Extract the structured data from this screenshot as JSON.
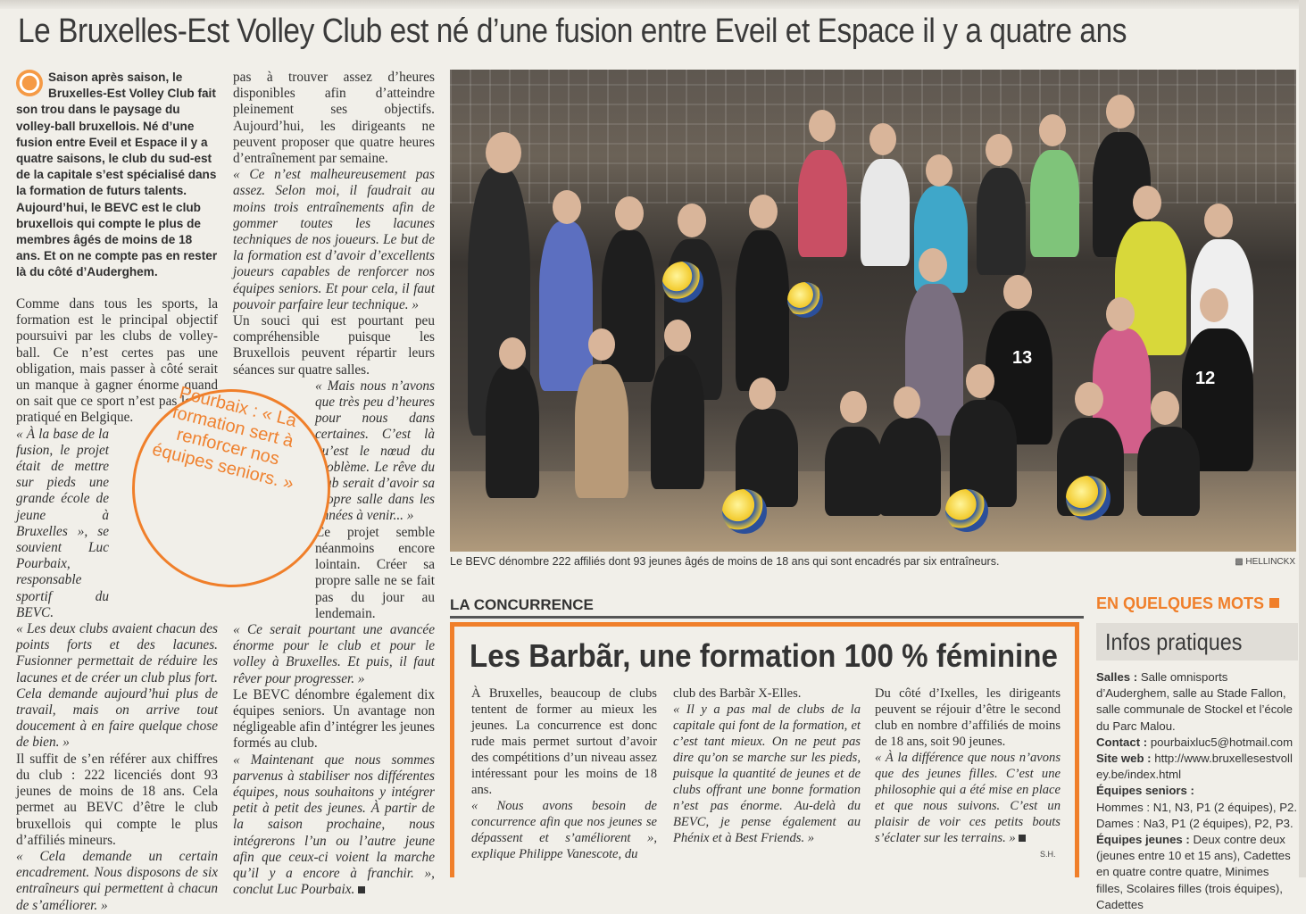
{
  "headline": "Le Bruxelles-Est Volley Club est né d’une fusion entre Eveil et Espace il y a quatre ans",
  "lead": "Saison après saison, le Bruxelles-Est Volley Club fait son trou dans le paysage du volley-ball bruxellois. Né d’une fusion entre Eveil et Espace il y a quatre saisons, le club du sud-est de la capitale s’est spécialisé dans la formation de futurs talents. Aujourd’hui, le BEVC est le club bruxellois qui compte le plus de membres âgés de moins de 18 ans. Et on ne compte pas en rester là du côté d’Auderghem.",
  "col1": {
    "p1": "Comme dans tous les sports, la formation est le principal objectif poursuivi par les clubs de volley-ball. Ce n’est certes pas une obligation, mais passer à côté serait un manque à gagner énorme quand on sait que ce sport n’est pas le plus pratiqué en Belgique.",
    "p2": "« À la base de la fusion, le projet était de mettre sur pieds une grande école de jeune à Bruxelles », se souvient Luc Pourbaix, responsable sportif du BEVC.",
    "p3": "« Les deux clubs avaient chacun des points forts et des lacunes. Fusionner permettait de réduire les lacunes et de créer un club plus fort. Cela demande aujourd’hui plus de travail, mais on arrive tout doucement à en faire quelque chose de bien. »",
    "p4": "Il suffit de s’en référer aux chiffres du club : 222 licenciés dont 93 jeunes de moins de 18 ans. Cela permet au BEVC d’être le club bruxellois qui compte le plus d’affiliés mineurs.",
    "p5": "« Cela demande un certain encadrement. Nous disposons de six entraîneurs qui permettent à chacun de s’améliorer. »"
  },
  "col2": {
    "p1": "pas à trouver assez d’heures disponibles afin d’atteindre pleinement ses objectifs. Aujourd’hui, les dirigeants ne peuvent proposer que quatre heures d’entraînement par semaine.",
    "p2": "« Ce n’est malheureusement pas assez. Selon moi, il faudrait au moins trois entraînements afin de gommer toutes les lacunes techniques de nos joueurs. Le but de la formation est d’avoir d’excellents joueurs capables de renforcer nos équipes seniors. Et pour cela, il faut pouvoir parfaire leur technique. »",
    "p3": "Un souci qui est pourtant peu compréhensible puisque les Bruxellois peuvent répartir leurs séances sur quatre salles.",
    "p4": "« Mais nous n’avons que très peu d’heures pour nous dans certaines. C’est là qu’est le nœud du problème. Le rêve du club serait d’avoir sa propre salle dans les années à venir... »",
    "p5": "Ce projet semble néanmoins encore lointain. Créer sa propre salle ne se fait pas du jour au lendemain.",
    "p6": "« Ce serait pourtant une avancée énorme pour le club et pour le volley à Bruxelles. Et puis, il faut rêver pour progresser. »",
    "p7": "Le BEVC dénombre également dix équipes seniors. Un avantage non négligeable afin d’intégrer les jeunes formés au club.",
    "p8": "« Maintenant que nous sommes parvenus à stabiliser nos différentes équipes, nous souhaitons y intégrer petit à petit des jeunes. À partir de la saison prochaine, nous intégrerons l’un ou l’autre jeune afin que ceux-ci voient la marche qu’il y a encore à franchir. », conclut Luc Pourbaix."
  },
  "pullquote": "Pourbaix : « La formation sert à renforcer nos équipes seniors. »",
  "photo_caption": "Le BEVC dénombre 222 affiliés dont 93 jeunes âgés de moins de 18 ans qui sont encadrés par six entraîneurs.",
  "photo_credit": "HELLINCKX",
  "jersey_numbers": [
    "13",
    "12"
  ],
  "concurrence": {
    "kicker": "LA CONCURRENCE",
    "title": "Les Barbãr, une formation 100 % féminine",
    "c1": "À Bruxelles, beaucoup de clubs tentent de former au mieux les jeunes. La concurrence est donc rude mais permet surtout d’avoir des compétitions d’un niveau assez intéressant pour les moins de 18 ans.",
    "c1b": "« Nous avons besoin de concurrence afin que nos jeunes se dépassent et s’améliorent », explique Philippe Vanescote, du",
    "c2": "club des Barbãr X-Elles.",
    "c2b": "« Il y a pas mal de clubs de la capitale qui font de la formation, et c’est tant mieux. On ne peut pas dire qu’on se marche sur les pieds, puisque la quantité de jeunes et de clubs offrant une bonne formation n’est pas énorme. Au-delà du BEVC, je pense également au Phénix et à Best Friends. »",
    "c3": "Du côté d’Ixelles, les dirigeants peuvent se réjouir d’être le second club en nombre d’affiliés de moins de 18 ans, soit 90 jeunes.",
    "c3b": "« À la différence que nous n’avons que des jeunes filles. C’est une philosophie qui a été mise en place et que nous suivons. C’est un plaisir de voir ces petits bouts s’éclater sur les terrains. »",
    "signature": "S.H."
  },
  "sidebar": {
    "kicker": "EN QUELQUES MOTS",
    "title": "Infos pratiques",
    "salles_label": "Salles :",
    "salles": "Salle omnisports d’Auderghem, salle au Stade Fallon, salle communale de Stockel et l’école du Parc Malou.",
    "contact_label": "Contact :",
    "contact": "pourbaixluc5@hotmail.com",
    "site_label": "Site web :",
    "site": "http://www.bruxellesestvolley.be/index.html",
    "seniors_label": "Équipes seniors :",
    "hommes": "Hommes : N1, N3, P1 (2 équipes), P2.",
    "dames": "Dames : Na3, P1 (2 équipes), P2, P3.",
    "jeunes_label": "Équipes jeunes :",
    "jeunes": "Deux contre deux (jeunes entre 10 et 15 ans), Cadettes en quatre contre quatre, Minimes filles, Scolaires filles (trois équipes), Cadettes"
  }
}
